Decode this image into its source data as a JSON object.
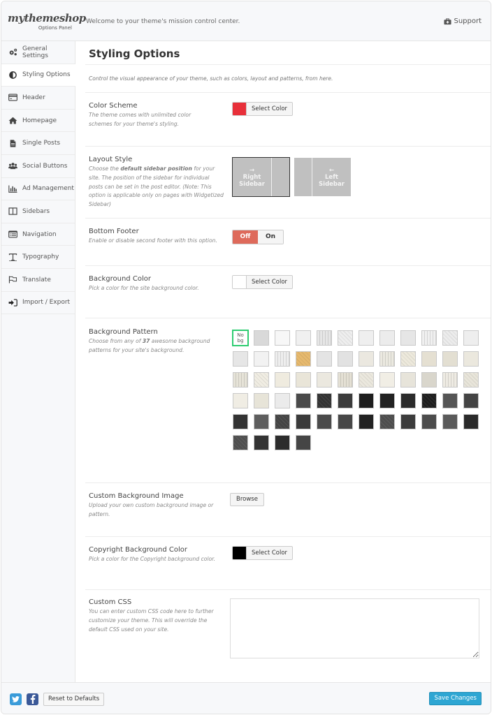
{
  "header": {
    "logo_text": "mythemeshop",
    "logo_subtitle": "Options Panel",
    "welcome": "Welcome to your theme's mission control center.",
    "support_label": "Support"
  },
  "sidebar": {
    "items": [
      {
        "label": "General Settings",
        "icon": "gears-icon",
        "active": false
      },
      {
        "label": "Styling Options",
        "icon": "contrast-icon",
        "active": true
      },
      {
        "label": "Header",
        "icon": "header-card-icon",
        "active": false
      },
      {
        "label": "Homepage",
        "icon": "home-icon",
        "active": false
      },
      {
        "label": "Single Posts",
        "icon": "document-icon",
        "active": false
      },
      {
        "label": "Social Buttons",
        "icon": "users-icon",
        "active": false
      },
      {
        "label": "Ad Management",
        "icon": "bar-chart-icon",
        "active": false
      },
      {
        "label": "Sidebars",
        "icon": "columns-icon",
        "active": false
      },
      {
        "label": "Navigation",
        "icon": "list-card-icon",
        "active": false
      },
      {
        "label": "Typography",
        "icon": "text-icon",
        "active": false
      },
      {
        "label": "Translate",
        "icon": "flag-icon",
        "active": false
      },
      {
        "label": "Import / Export",
        "icon": "sign-in-icon",
        "active": false
      }
    ]
  },
  "main": {
    "title": "Styling Options",
    "intro": "Control the visual appearance of your theme, such as colors, layout and patterns, from here.",
    "color_scheme": {
      "title": "Color Scheme",
      "desc": "The theme comes with unlimited color schemes for your theme's styling.",
      "button_label": "Select Color",
      "value": "#e8303a"
    },
    "layout_style": {
      "title": "Layout Style",
      "desc_pre": "Choose the ",
      "desc_bold": "default sidebar position",
      "desc_post": " for your site. The position of the sidebar for individual posts can be set in the post editor. (Note: This option is applicable only on pages with Widgetized Sidebar)",
      "options": [
        {
          "arrow": "→",
          "label1": "Right",
          "label2": "Sidebar",
          "selected": true
        },
        {
          "arrow": "←",
          "label1": "Left",
          "label2": "Sidebar",
          "selected": false
        }
      ]
    },
    "bottom_footer": {
      "title": "Bottom Footer",
      "desc": "Enable or disable second footer with this option.",
      "off_label": "Off",
      "on_label": "On",
      "value": "Off"
    },
    "background_color": {
      "title": "Background Color",
      "desc": "Pick a color for the site background color.",
      "button_label": "Select Color",
      "value": "#ffffff"
    },
    "background_pattern": {
      "title": "Background Pattern",
      "desc_pre": "Choose from any of ",
      "desc_bold": "37",
      "desc_post": " awesome background patterns for your site's background.",
      "nobg_label_1": "No",
      "nobg_label_2": "bg",
      "selected": "nobg",
      "swatches": [
        "#d9d9d9",
        "#f7f7f7",
        "#f0f0f0",
        "#e6e6e6",
        "#eeeeee",
        "#efefef",
        "#ececec",
        "#e6e6e6",
        "#f0f0f0",
        "#ececec",
        "#eeeeee",
        "#e6e6e6",
        "#f2f2f2",
        "#eeeeee",
        "#e6b96e",
        "#e4e4e4",
        "#e2e2e2",
        "#ebe8e0",
        "#ebe9e0",
        "#ede9dc",
        "#e5e0d2",
        "#e3dfd2",
        "#ebe8de",
        "#e6e3d8",
        "#f0ede3",
        "#efebdf",
        "#e9e5d8",
        "#ebe8df",
        "#e4e0d4",
        "#ebe8de",
        "#f1eee5",
        "#e7e4da",
        "#d9d6cc",
        "#eeebe3",
        "#e8e5da",
        "#f0ede4",
        "#e7e4d8",
        "#ebebeb",
        "#4a4a4a",
        "#333333",
        "#3c3c3c",
        "#1e1e1e",
        "#222222",
        "#2b2b2b",
        "#1e1e1e",
        "#555555",
        "#444444",
        "#333333",
        "#5e5e5e",
        "#444444",
        "#3a3a3a",
        "#4a4a4a",
        "#474747",
        "#222222",
        "#4d4d4d",
        "#3c3c3c",
        "#4c4c4c",
        "#5a5a5a",
        "#2a2a2a",
        "#4f4f4f",
        "#333333",
        "#2c2c2c",
        "#454545"
      ]
    },
    "custom_bg_image": {
      "title": "Custom Background Image",
      "desc": "Upload your own custom background image or pattern.",
      "button_label": "Browse"
    },
    "copyright_bg_color": {
      "title": "Copyright Background Color",
      "desc": "Pick a color for the Copyright background color.",
      "button_label": "Select Color",
      "value": "#000000"
    },
    "custom_css": {
      "title": "Custom CSS",
      "desc": "You can enter custom CSS code here to further customize your theme. This will override the default CSS used on your site.",
      "value": ""
    }
  },
  "footer": {
    "reset_label": "Reset to Defaults",
    "save_label": "Save Changes"
  }
}
